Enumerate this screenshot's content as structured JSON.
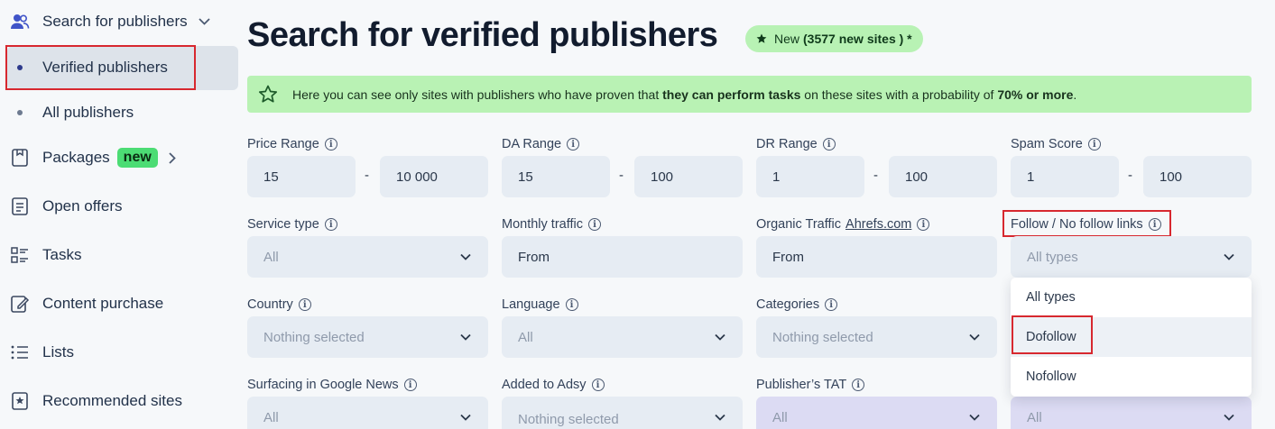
{
  "sidebar": {
    "section_title": "Search for publishers",
    "items": [
      {
        "label": "Verified publishers"
      },
      {
        "label": "All publishers"
      },
      {
        "label": "Packages",
        "badge": "new"
      },
      {
        "label": "Open offers"
      },
      {
        "label": "Tasks"
      },
      {
        "label": "Content purchase"
      },
      {
        "label": "Lists"
      },
      {
        "label": "Recommended sites"
      }
    ],
    "icons": [
      "users-icon",
      "package-icon",
      "document-icon",
      "tasks-icon",
      "edit-icon",
      "list-icon",
      "star-icon"
    ]
  },
  "header": {
    "title": "Search for verified publishers",
    "pill_prefix": "New",
    "pill_count": "(3577 new sites ) *"
  },
  "banner": {
    "text_before": "Here you can see only sites with publishers who have proven that ",
    "text_bold": "they can perform tasks",
    "text_middle": " on these sites with a probability of ",
    "text_bold2": "70% or more",
    "text_end": "."
  },
  "filters": {
    "price_range": {
      "label": "Price Range",
      "from": "15",
      "to": "10 000"
    },
    "da_range": {
      "label": "DA Range",
      "from": "15",
      "to": "100"
    },
    "dr_range": {
      "label": "DR Range",
      "from": "1",
      "to": "100"
    },
    "spam_score": {
      "label": "Spam Score",
      "from": "1",
      "to": "100"
    },
    "range_separator": "-",
    "service_type": {
      "label": "Service type",
      "value": "All"
    },
    "monthly_traffic": {
      "label": "Monthly traffic",
      "value": "From"
    },
    "organic_traffic": {
      "label": "Organic Traffic",
      "link": "Ahrefs.com",
      "value": "From"
    },
    "follow_links": {
      "label": "Follow / No follow links",
      "value": "All types"
    },
    "country": {
      "label": "Country",
      "value": "Nothing selected"
    },
    "language": {
      "label": "Language",
      "value": "All"
    },
    "categories": {
      "label": "Categories",
      "value": "Nothing selected"
    },
    "google_news": {
      "label": "Surfacing in Google News",
      "value": "All"
    },
    "added_to_adsy": {
      "label": "Added to Adsy",
      "value": "Nothing selected"
    },
    "publisher_tat": {
      "label": "Publisher’s TAT",
      "value": "All"
    },
    "last_col_value": "All"
  },
  "follow_dropdown": {
    "options": [
      "All types",
      "Dofollow",
      "Nofollow"
    ]
  },
  "colors": {
    "highlight_red": "#d7282f",
    "banner_green": "#b9f2b4",
    "badge_green": "#4cdc74",
    "input_bg": "#e6ecf3",
    "tat_bg": "#dcdbf3"
  }
}
